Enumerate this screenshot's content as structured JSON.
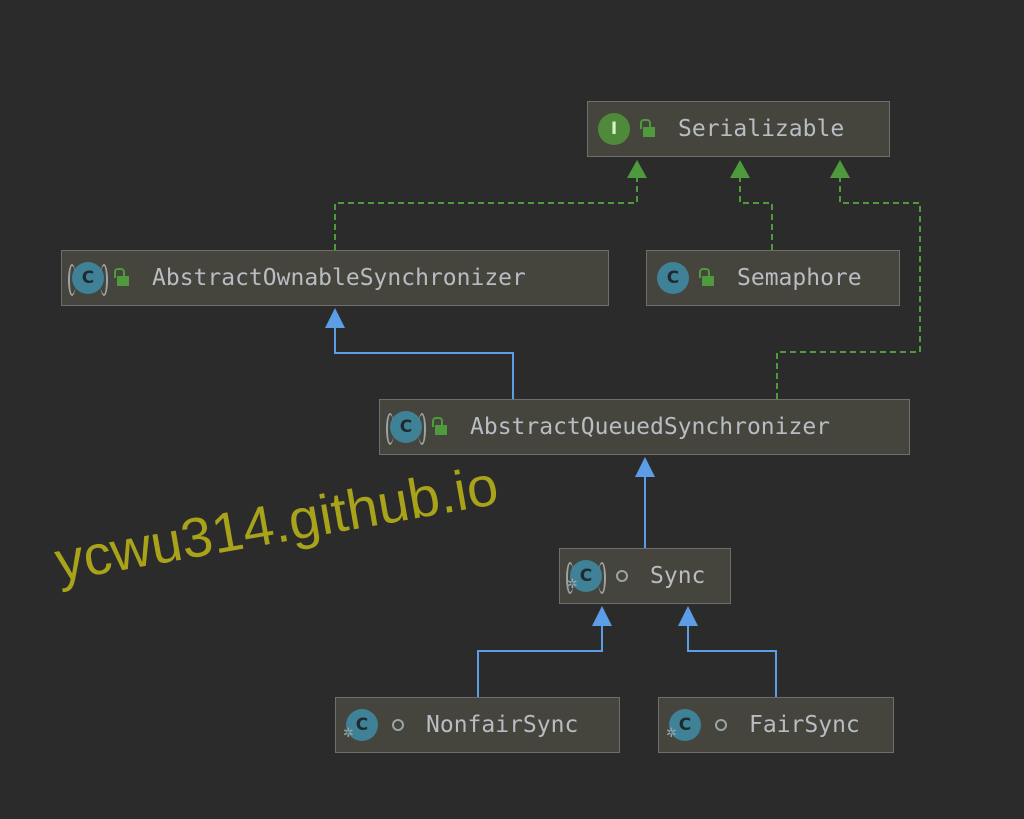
{
  "diagram": {
    "nodes": [
      {
        "id": "serializable",
        "label": "Serializable",
        "kind": "interface",
        "kind_letter": "I",
        "visibility": "public"
      },
      {
        "id": "aos",
        "label": "AbstractOwnableSynchronizer",
        "kind": "abstract-class",
        "kind_letter": "C",
        "visibility": "public"
      },
      {
        "id": "semaphore",
        "label": "Semaphore",
        "kind": "class",
        "kind_letter": "C",
        "visibility": "public"
      },
      {
        "id": "aqs",
        "label": "AbstractQueuedSynchronizer",
        "kind": "abstract-class",
        "kind_letter": "C",
        "visibility": "public"
      },
      {
        "id": "sync",
        "label": "Sync",
        "kind": "abstract-class",
        "kind_letter": "C",
        "visibility": "package-private"
      },
      {
        "id": "nonfair",
        "label": "NonfairSync",
        "kind": "class",
        "kind_letter": "C",
        "visibility": "package-private"
      },
      {
        "id": "fair",
        "label": "FairSync",
        "kind": "class",
        "kind_letter": "C",
        "visibility": "package-private"
      }
    ],
    "edges": [
      {
        "from": "aos",
        "to": "serializable",
        "type": "implements"
      },
      {
        "from": "semaphore",
        "to": "serializable",
        "type": "implements"
      },
      {
        "from": "aqs",
        "to": "serializable",
        "type": "implements"
      },
      {
        "from": "aqs",
        "to": "aos",
        "type": "extends"
      },
      {
        "from": "sync",
        "to": "aqs",
        "type": "extends"
      },
      {
        "from": "nonfair",
        "to": "sync",
        "type": "extends"
      },
      {
        "from": "fair",
        "to": "sync",
        "type": "extends"
      }
    ],
    "colors": {
      "background": "#2b2b2b",
      "node_fill": "#45443d",
      "extends_edge": "#5c9ee6",
      "implements_edge": "#4f9a3c",
      "watermark": "#a8a31a"
    }
  },
  "watermark": "ycwu314.github.io"
}
